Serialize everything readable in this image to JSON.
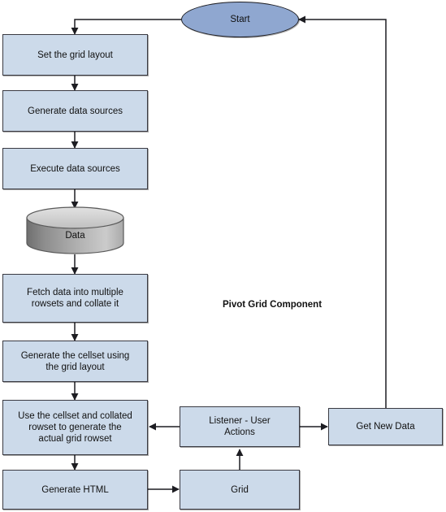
{
  "diagram": {
    "title_text": "Pivot Grid Component",
    "colors": {
      "process_fill": "#ccdaea",
      "process_stroke": "#3a3a42",
      "terminator_fill": "#8fa7d0",
      "terminator_stroke": "#1d1d22",
      "cylinder_top_fill": "#cfcfcf",
      "cylinder_body_dark": "#787878",
      "cylinder_body_light": "#cacaca",
      "connector_stroke": "#1d1d22",
      "background": "#ffffff",
      "text": "#111111"
    },
    "nodes": {
      "start": {
        "label": "Start",
        "shape": "ellipse"
      },
      "set_grid_layout": {
        "label": "Set the grid layout",
        "shape": "rect"
      },
      "generate_data_sources": {
        "label": "Generate data sources",
        "shape": "rect"
      },
      "execute_data_sources": {
        "label": "Execute data sources",
        "shape": "rect"
      },
      "data_store": {
        "label": "Data",
        "shape": "cylinder"
      },
      "fetch_data": {
        "label": "Fetch data into multiple\nrowsets and collate it",
        "shape": "rect"
      },
      "generate_cellset": {
        "label": "Generate the cellset using\nthe grid layout",
        "shape": "rect"
      },
      "use_cellset": {
        "label": "Use the cellset and collated\nrowset to generate the\nactual grid rowset",
        "shape": "rect"
      },
      "generate_html": {
        "label": "Generate HTML",
        "shape": "rect"
      },
      "grid": {
        "label": "Grid",
        "shape": "rect"
      },
      "listener_user_actions": {
        "label": "Listener - User\nActions",
        "shape": "rect"
      },
      "get_new_data": {
        "label": "Get New Data",
        "shape": "rect"
      }
    },
    "edges": [
      {
        "from": "start",
        "to": "set_grid_layout"
      },
      {
        "from": "set_grid_layout",
        "to": "generate_data_sources"
      },
      {
        "from": "generate_data_sources",
        "to": "execute_data_sources"
      },
      {
        "from": "execute_data_sources",
        "to": "data_store"
      },
      {
        "from": "data_store",
        "to": "fetch_data"
      },
      {
        "from": "fetch_data",
        "to": "generate_cellset"
      },
      {
        "from": "generate_cellset",
        "to": "use_cellset"
      },
      {
        "from": "use_cellset",
        "to": "generate_html"
      },
      {
        "from": "generate_html",
        "to": "grid"
      },
      {
        "from": "grid",
        "to": "listener_user_actions"
      },
      {
        "from": "listener_user_actions",
        "to": "use_cellset"
      },
      {
        "from": "listener_user_actions",
        "to": "get_new_data"
      },
      {
        "from": "get_new_data",
        "to": "start"
      }
    ]
  }
}
